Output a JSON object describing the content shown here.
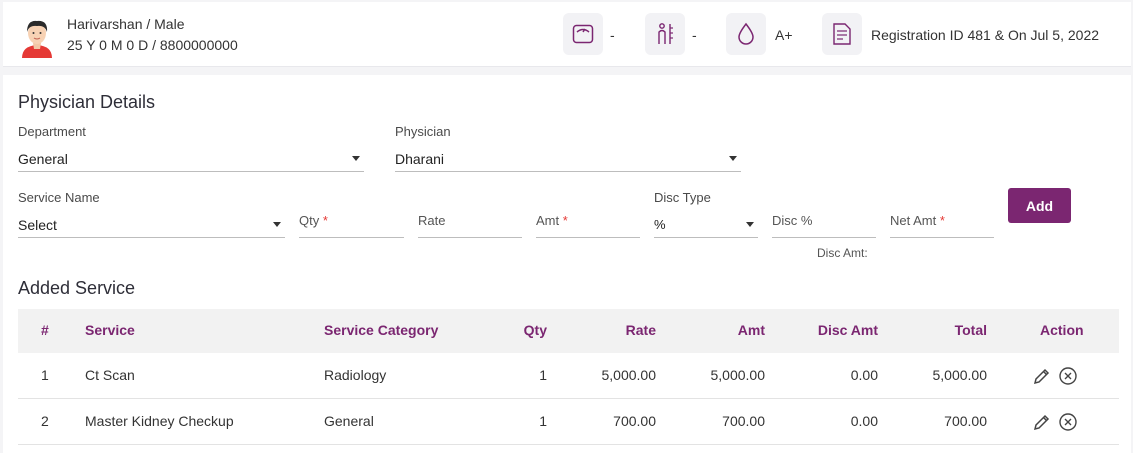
{
  "patient": {
    "name_gender": "Harivarshan / Male",
    "age_phone": "25 Y 0 M 0 D / 8800000000",
    "weight": "-",
    "height": "-",
    "blood_group": "A+",
    "registration": "Registration ID 481 & On Jul 5, 2022"
  },
  "physician_details": {
    "title": "Physician Details",
    "department_label": "Department",
    "department_value": "General",
    "physician_label": "Physician",
    "physician_value": "Dharani",
    "service_name_label": "Service Name",
    "service_name_value": "Select",
    "qty_placeholder": "Qty",
    "rate_placeholder": "Rate",
    "amt_placeholder": "Amt",
    "disc_type_label": "Disc Type",
    "disc_type_value": "%",
    "disc_pct_placeholder": "Disc %",
    "net_amt_placeholder": "Net Amt",
    "required_mark": "*",
    "disc_amt_label": "Disc Amt:",
    "add_label": "Add"
  },
  "added_service": {
    "title": "Added Service",
    "columns": [
      "#",
      "Service",
      "Service Category",
      "Qty",
      "Rate",
      "Amt",
      "Disc Amt",
      "Total",
      "Action"
    ],
    "rows": [
      {
        "no": "1",
        "service": "Ct Scan",
        "category": "Radiology",
        "qty": "1",
        "rate": "5,000.00",
        "amt": "5,000.00",
        "disc_amt": "0.00",
        "total": "5,000.00"
      },
      {
        "no": "2",
        "service": "Master Kidney Checkup",
        "category": "General",
        "qty": "1",
        "rate": "700.00",
        "amt": "700.00",
        "disc_amt": "0.00",
        "total": "700.00"
      }
    ]
  },
  "colors": {
    "accent": "#7b2671",
    "required": "#e53935"
  },
  "icons": {
    "avatar": "avatar-icon",
    "weight": "weighing-scale-icon",
    "height": "height-measure-icon",
    "blood": "blood-drop-icon",
    "registration": "document-icon",
    "edit": "pencil-icon",
    "delete": "circle-x-icon"
  }
}
